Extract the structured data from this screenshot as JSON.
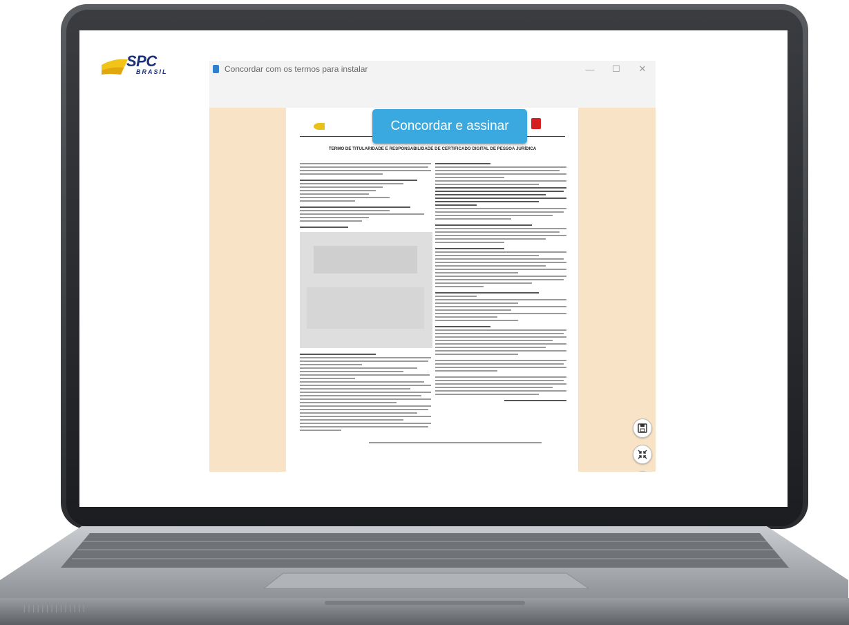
{
  "brand": {
    "name": "SPC",
    "sub": "BRASIL"
  },
  "window": {
    "title": "Concordar com os termos para instalar",
    "controls": {
      "minimize": "—",
      "maximize": "☐",
      "close": "✕"
    }
  },
  "action": {
    "agree_label": "Concordar e assinar"
  },
  "document": {
    "title": "TERMO DE TITULARIDADE E RESPONSABILIDADE DE CERTIFICADO DIGITAL DE PESSOA JURÍDICA"
  },
  "tools": {
    "save_icon": "save-icon",
    "collapse_icon": "collapse-icon"
  },
  "colors": {
    "accent": "#3aa9df",
    "doc_bg": "#f9e3c7",
    "brand_blue": "#1b2f7a",
    "brand_yellow": "#f2c318"
  }
}
